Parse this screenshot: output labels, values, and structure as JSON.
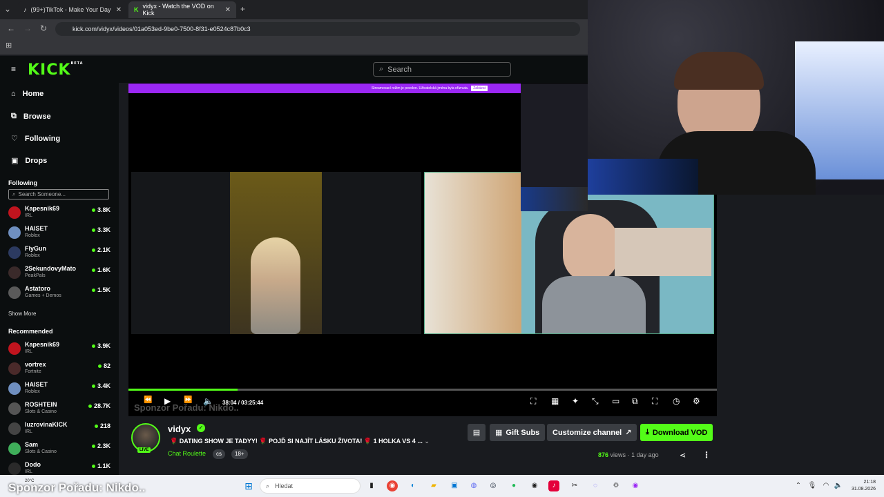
{
  "browser": {
    "tabs": [
      {
        "title": "(99+)TikTok - Make Your Day",
        "active": false
      },
      {
        "title": "vidyx - Watch the VOD on Kick",
        "active": true
      }
    ],
    "url": "kick.com/vidyx/videos/01a053ed-9be0-7500-8f31-e0524c87b0c3"
  },
  "header": {
    "logo": "KICK",
    "logo_badge": "BETA",
    "search_placeholder": "Search"
  },
  "sidebar": {
    "nav": [
      {
        "label": "Home",
        "icon": "home-icon"
      },
      {
        "label": "Browse",
        "icon": "browse-icon"
      },
      {
        "label": "Following",
        "icon": "heart-icon"
      },
      {
        "label": "Drops",
        "icon": "gift-icon"
      }
    ],
    "following_title": "Following",
    "following_search_placeholder": "Search Someone...",
    "following": [
      {
        "name": "Kapesnik69",
        "category": "IRL",
        "viewers": "3.8K"
      },
      {
        "name": "HAISET",
        "category": "Roblox",
        "viewers": "3.3K"
      },
      {
        "name": "FlyGun",
        "category": "Roblox",
        "viewers": "2.1K"
      },
      {
        "name": "2SekundovyMato",
        "category": "PeakPals",
        "viewers": "1.6K"
      },
      {
        "name": "Astatoro",
        "category": "Games + Demos",
        "viewers": "1.5K"
      }
    ],
    "show_more": "Show More",
    "recommended_title": "Recommended",
    "recommended": [
      {
        "name": "Kapesnik69",
        "category": "IRL",
        "viewers": "3.9K"
      },
      {
        "name": "vortrex",
        "category": "Fortnite",
        "viewers": "82"
      },
      {
        "name": "HAISET",
        "category": "Roblox",
        "viewers": "3.4K"
      },
      {
        "name": "ROSHTEIN",
        "category": "Slots & Casino",
        "viewers": "28.7K"
      },
      {
        "name": "luzrovinaKICK",
        "category": "IRL",
        "viewers": "218"
      },
      {
        "name": "Sam",
        "category": "Slots & Casino",
        "viewers": "2.3K"
      },
      {
        "name": "Dodo",
        "category": "IRL",
        "viewers": "1.1K"
      }
    ]
  },
  "player": {
    "banner_text": "Streamovací režim je povolen. Uživatelská jména byla ořiznuta.",
    "banner_button": "Zakázat",
    "time_current": "38:04",
    "time_total": "03:25:44",
    "progress": 0.185,
    "overlay_sponsor": "Sponzor Pořadu: Nikdo.."
  },
  "channel": {
    "name": "vidyx",
    "live_badge": "LIVE",
    "title": "🌹 DATING SHOW JE TADYY! 🌹 POJĎ SI NAJÍT LÁSKU ŽIVOTA! 🌹 1 HOLKA VS 4 ...",
    "category": "Chat Roulette",
    "tags": [
      "cs",
      "18+"
    ],
    "gift_subs": "Gift Subs",
    "customize": "Customize channel",
    "download": "Download VOD",
    "views_count": "876",
    "views_label": "views",
    "age": "1 day ago"
  },
  "taskbar": {
    "search_placeholder": "Hledat",
    "weather": "20°C",
    "time": "21:18",
    "date": "31.08.2026"
  },
  "overlay": {
    "sponsor_text": "Sponzor Pořadu: Nikdo.."
  },
  "colors": {
    "accent": "#53fc18",
    "banner": "#9b27f5",
    "background": "#191b1f"
  }
}
